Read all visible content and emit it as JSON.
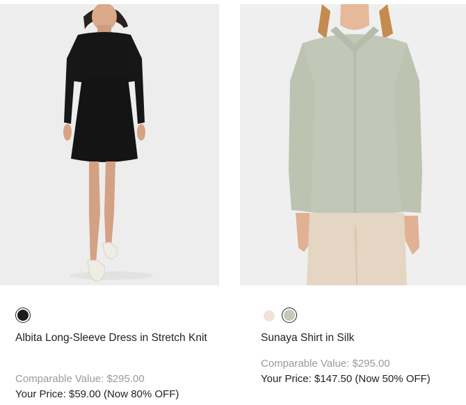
{
  "products": [
    {
      "name": "Albita Long-Sleeve Dress in Stretch Knit",
      "comparable_value": "Comparable Value: $295.00",
      "your_price": "Your Price: $59.00 (Now 80% OFF)",
      "image_icon": "dress-photo",
      "swatches": [
        {
          "color": "#1c1c1c",
          "selected": true
        }
      ]
    },
    {
      "name": "Sunaya Shirt in Silk",
      "comparable_value": "Comparable Value: $295.00",
      "your_price": "Your Price: $147.50 (Now 50% OFF)",
      "image_icon": "shirt-photo",
      "swatches": [
        {
          "color": "#f3e2d8",
          "selected": false
        },
        {
          "color": "#c4c9bb",
          "selected": true
        }
      ]
    }
  ]
}
